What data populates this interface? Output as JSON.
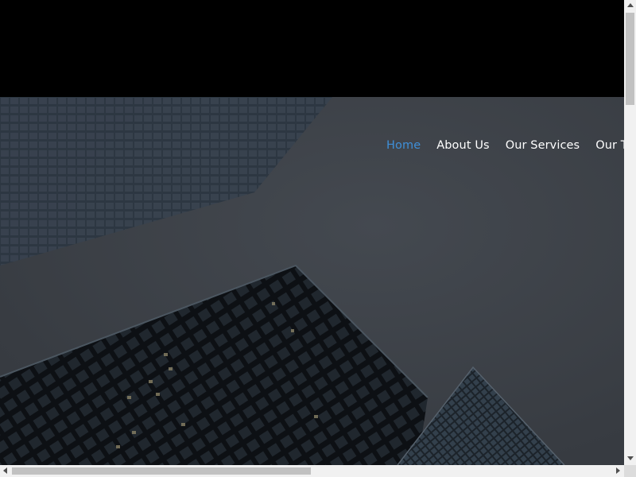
{
  "nav": {
    "items": [
      {
        "label": "Home",
        "active": true
      },
      {
        "label": "About Us",
        "active": false
      },
      {
        "label": "Our Services",
        "active": false
      },
      {
        "label": "Our Team",
        "active": false
      }
    ]
  },
  "colors": {
    "background": "#000000",
    "hero_overlay": "#3a3e45",
    "nav_text": "#ffffff",
    "nav_active": "#3f8fd8",
    "scrollbar_track": "#f1f1f1",
    "scrollbar_thumb": "#c1c1c1"
  },
  "hero": {
    "image": "skyscrapers-looking-up-photo"
  }
}
